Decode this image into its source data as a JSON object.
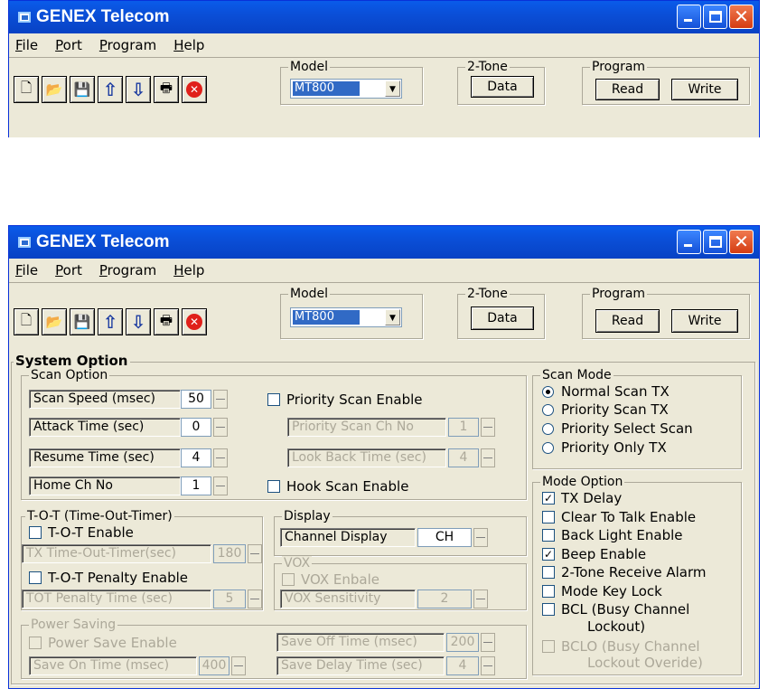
{
  "app": {
    "title": "GENEX Telecom"
  },
  "menu": [
    "File",
    "Port",
    "Program",
    "Help"
  ],
  "toolbar": {
    "icons": [
      "new-icon",
      "open-icon",
      "save-icon",
      "up-arrow-icon",
      "down-arrow-icon",
      "print-icon",
      "close-icon"
    ]
  },
  "model": {
    "label": "Model",
    "value": "MT800"
  },
  "two_tone": {
    "label": "2-Tone",
    "button": "Data"
  },
  "program": {
    "label": "Program",
    "read": "Read",
    "write": "Write"
  },
  "system_option": {
    "title": "System Option"
  },
  "scan_option": {
    "title": "Scan Option",
    "scan_speed": {
      "label": "Scan Speed (msec)",
      "value": "50"
    },
    "attack_time": {
      "label": "Attack Time (sec)",
      "value": "0"
    },
    "resume_time": {
      "label": "Resume Time (sec)",
      "value": "4"
    },
    "home_ch": {
      "label": "Home Ch No",
      "value": "1"
    },
    "priority_scan_enable": "Priority Scan Enable",
    "priority_scan_ch": {
      "label": "Priority Scan Ch No",
      "value": "1"
    },
    "look_back_time": {
      "label": "Look Back Time (sec)",
      "value": "4"
    },
    "hook_scan_enable": "Hook Scan Enable"
  },
  "tot": {
    "title": "T-O-T (Time-Out-Timer)",
    "enable": "T-O-T Enable",
    "tx_timer": {
      "label": "TX Time-Out-Timer(sec)",
      "value": "180"
    },
    "penalty_enable": "T-O-T Penalty Enable",
    "penalty_time": {
      "label": "TOT Penalty Time (sec)",
      "value": "5"
    }
  },
  "display": {
    "title": "Display",
    "label": "Channel Display",
    "value": "CH"
  },
  "vox": {
    "title": "VOX",
    "enable": "VOX Enbale",
    "sensitivity": {
      "label": "VOX Sensitivity",
      "value": "2"
    }
  },
  "power_saving": {
    "title": "Power Saving",
    "enable": "Power Save Enable",
    "save_on": {
      "label": "Save On Time (msec)",
      "value": "400"
    },
    "save_off": {
      "label": "Save Off Time (msec)",
      "value": "200"
    },
    "save_delay": {
      "label": "Save Delay Time (sec)",
      "value": "4"
    }
  },
  "scan_mode": {
    "title": "Scan Mode",
    "options": [
      "Normal Scan TX",
      "Priority Scan TX",
      "Priority Select Scan",
      "Priority Only TX"
    ],
    "selected": "Normal Scan TX"
  },
  "mode_option": {
    "title": "Mode Option",
    "tx_delay": "TX Delay",
    "clear_to_talk": "Clear To Talk Enable",
    "back_light": "Back Light Enable",
    "beep": "Beep Enable",
    "two_tone_alarm": "2-Tone Receive Alarm",
    "mode_key_lock": "Mode Key Lock",
    "bcl_1": "BCL (Busy Channel",
    "bcl_2": "Lockout)",
    "bclo_1": "BCLO (Busy Channel",
    "bclo_2": "Lockout Overide)",
    "checked": [
      "TX Delay",
      "Beep Enable"
    ]
  }
}
